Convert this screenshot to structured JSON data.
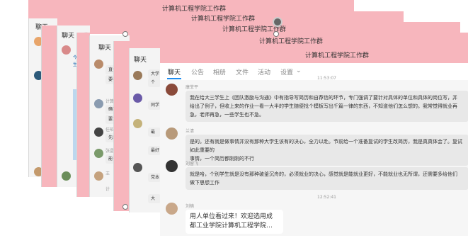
{
  "group_title": "计算机工程学院工作群",
  "layer_labels": {
    "liaotian": "聊天",
    "gonggao": "公告"
  },
  "stack": {
    "s2_snips": [
      "今年...",
      "生就"
    ],
    "s3_snips": [
      "直播中",
      "要看",
      "计算机",
      "确实是",
      "要求…",
      "任昭",
      "先就",
      "张晶",
      "能否",
      "王",
      "计"
    ],
    "s4_snips": [
      "大学",
      "个",
      "同学",
      "最",
      "最好",
      "党本",
      "大"
    ]
  },
  "main": {
    "tabs": [
      "聊天",
      "公告",
      "相册",
      "文件",
      "活动",
      "设置"
    ],
    "active_tab": "聊天",
    "top_time": "11:53:07",
    "messages": [
      {
        "name": "康菲平",
        "text": [
          "我在给大三学生上《团队激励与沟通》中有指导写简历和自荐信的环节，专门强调了要针对具体的单位和具体的岗位写，并",
          "给出了例子，但收上来的作业一看一大半的学生随便找个模板写出千篇一律的东西，不知道他们怎么想的。我常觉得就业再",
          "急，老师再急，一些学生也不急。"
        ]
      },
      {
        "name": "兰清",
        "text": [
          "是的。还有就是做事情并没有那种大学生该有的决心，全力以赴。节前给一个准备复试的学生改简历，我是真真体会了。复试如此重要的",
          "事情，一个简历都刚刚的不行"
        ]
      },
      {
        "name": "刘留飞",
        "text": [
          "就是哈，个别学生就是没有那种破釜沉舟的，必须就业的决心，感觉就是能就业更好，不能就业也无所谓，还需要多给他们",
          "做下思想工作"
        ]
      }
    ],
    "time2": "12:52:41",
    "last_name": "刘楠",
    "last_text": [
      "用人单位看过来！欢迎选用成",
      "都工业学院计算机工程学院…"
    ],
    "settings_caret": "⌄"
  },
  "colors": {
    "accent": "#1e8cf0",
    "titlebar": "#f7b6bd"
  }
}
